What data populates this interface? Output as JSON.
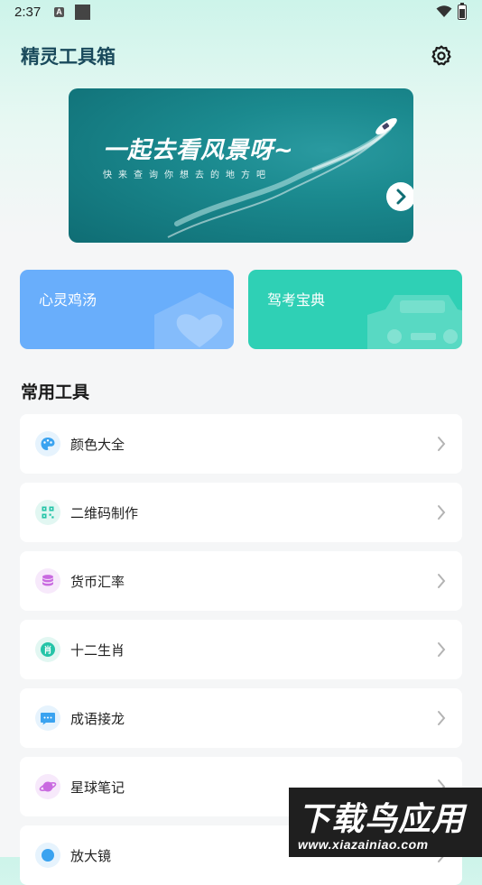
{
  "status_bar": {
    "time": "2:37",
    "notification_letter": "A"
  },
  "header": {
    "title": "精灵工具箱",
    "settings_icon": "gear-icon"
  },
  "banner": {
    "title": "一起去看风景呀~",
    "subtitle": "快来查询你想去的地方吧",
    "next_icon": "chevron-right-icon"
  },
  "cards": [
    {
      "label": "心灵鸡汤",
      "color": "#69aefb",
      "icon": "house-heart-icon"
    },
    {
      "label": "驾考宝典",
      "color": "#2fd0b5",
      "icon": "car-icon"
    }
  ],
  "tools": {
    "section_title": "常用工具",
    "items": [
      {
        "label": "颜色大全",
        "icon": "palette-icon",
        "color": "#3aa3f0"
      },
      {
        "label": "二维码制作",
        "icon": "qr-code-icon",
        "color": "#25c4a8"
      },
      {
        "label": "货币汇率",
        "icon": "coin-stack-icon",
        "color": "#c96ae0"
      },
      {
        "label": "十二生肖",
        "icon": "zodiac-icon",
        "color": "#25c4a8",
        "glyph": "肖"
      },
      {
        "label": "成语接龙",
        "icon": "chat-bubble-icon",
        "color": "#3aa3f0"
      },
      {
        "label": "星球笔记",
        "icon": "planet-icon",
        "color": "#c96ae0"
      },
      {
        "label": "放大镜",
        "icon": "magnifier-icon",
        "color": "#3aa3f0"
      }
    ]
  },
  "watermark": {
    "title": "下载鸟应用",
    "url": "www.xiazainiao.com"
  }
}
